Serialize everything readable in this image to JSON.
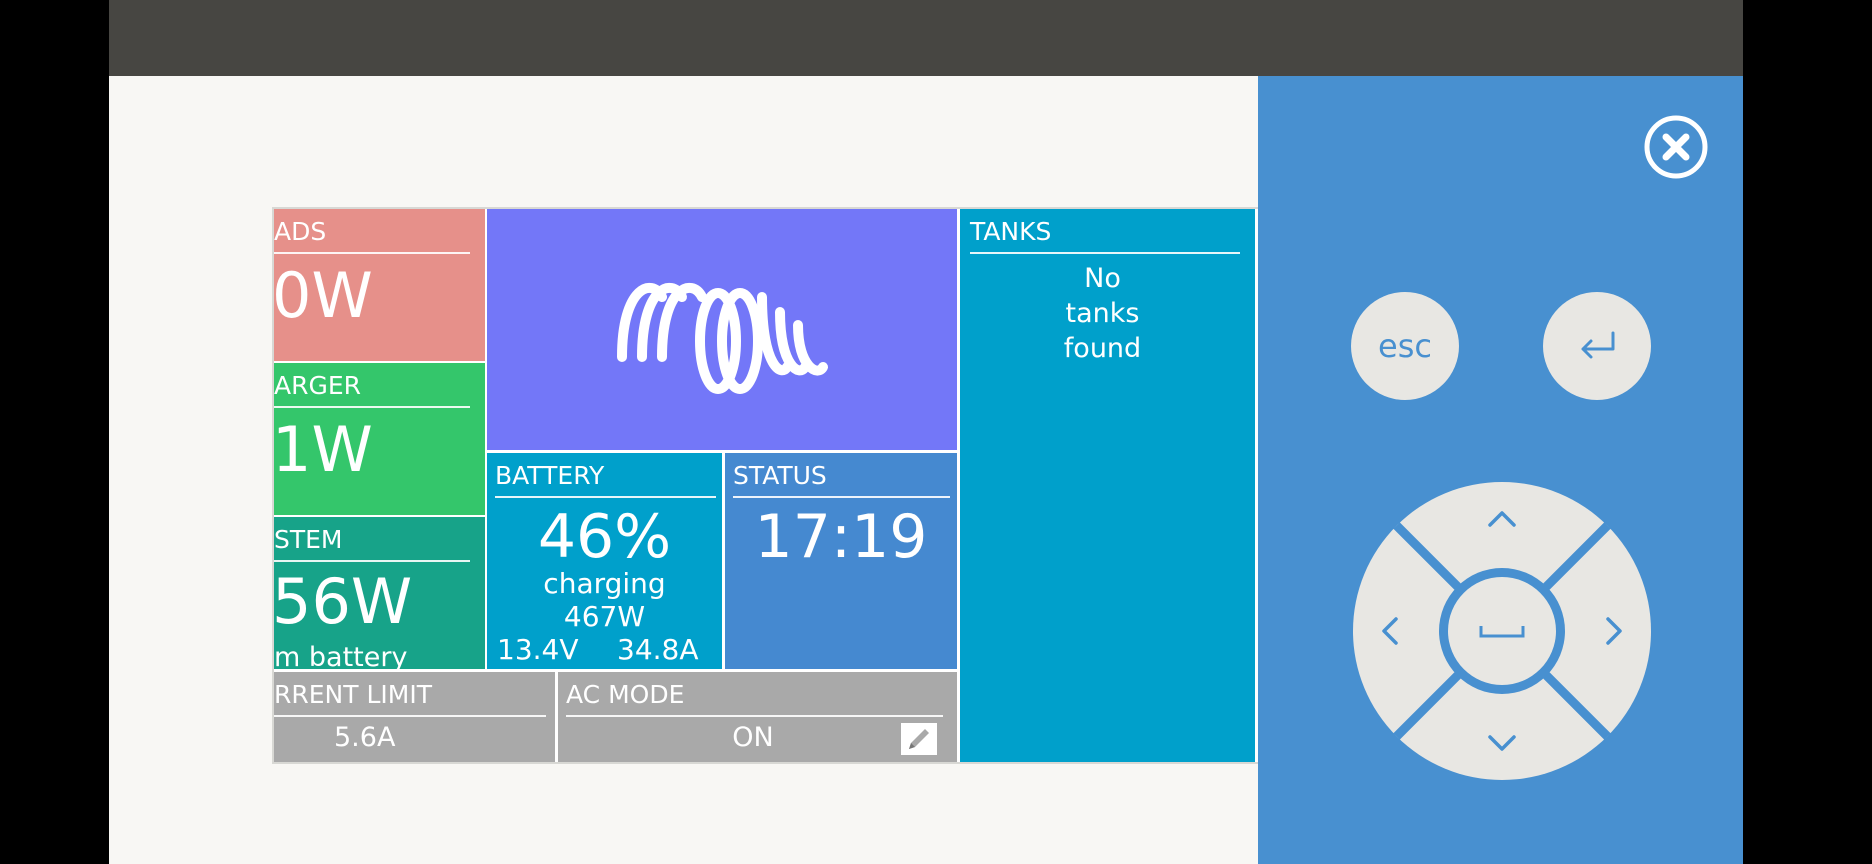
{
  "tiles": {
    "loads": {
      "title": "ADS",
      "value": "0W"
    },
    "charger": {
      "title": "ARGER",
      "value": "1W"
    },
    "system": {
      "title": "STEM",
      "value": "56W",
      "sub": "m battery"
    },
    "battery": {
      "title": "BATTERY",
      "percent": "46%",
      "state": "charging",
      "power": "467W",
      "voltage": "13.4V",
      "current": "34.8A"
    },
    "status": {
      "title": "STATUS",
      "time": "17:19"
    },
    "tanks": {
      "title": "TANKS",
      "message": "No tanks found"
    },
    "current_limit": {
      "title": "RRENT LIMIT",
      "value": "5.6A"
    },
    "ac_mode": {
      "title": "AC MODE",
      "value": "ON"
    }
  },
  "panel": {
    "esc_label": "esc"
  },
  "colors": {
    "topbar": "#474642",
    "panel": "#4890d0",
    "loads": "#e6908a",
    "charger": "#34c66b",
    "system": "#17a389",
    "logo": "#7377f8",
    "battery": "#00a0cb",
    "status": "#4589d0",
    "tanks": "#00a0cb",
    "control_gray": "#a9a9a9"
  },
  "icons": [
    "victron-logo",
    "close-icon",
    "esc-icon",
    "enter-icon",
    "up-arrow-icon",
    "down-arrow-icon",
    "left-arrow-icon",
    "right-arrow-icon",
    "space-icon",
    "edit-icon"
  ]
}
